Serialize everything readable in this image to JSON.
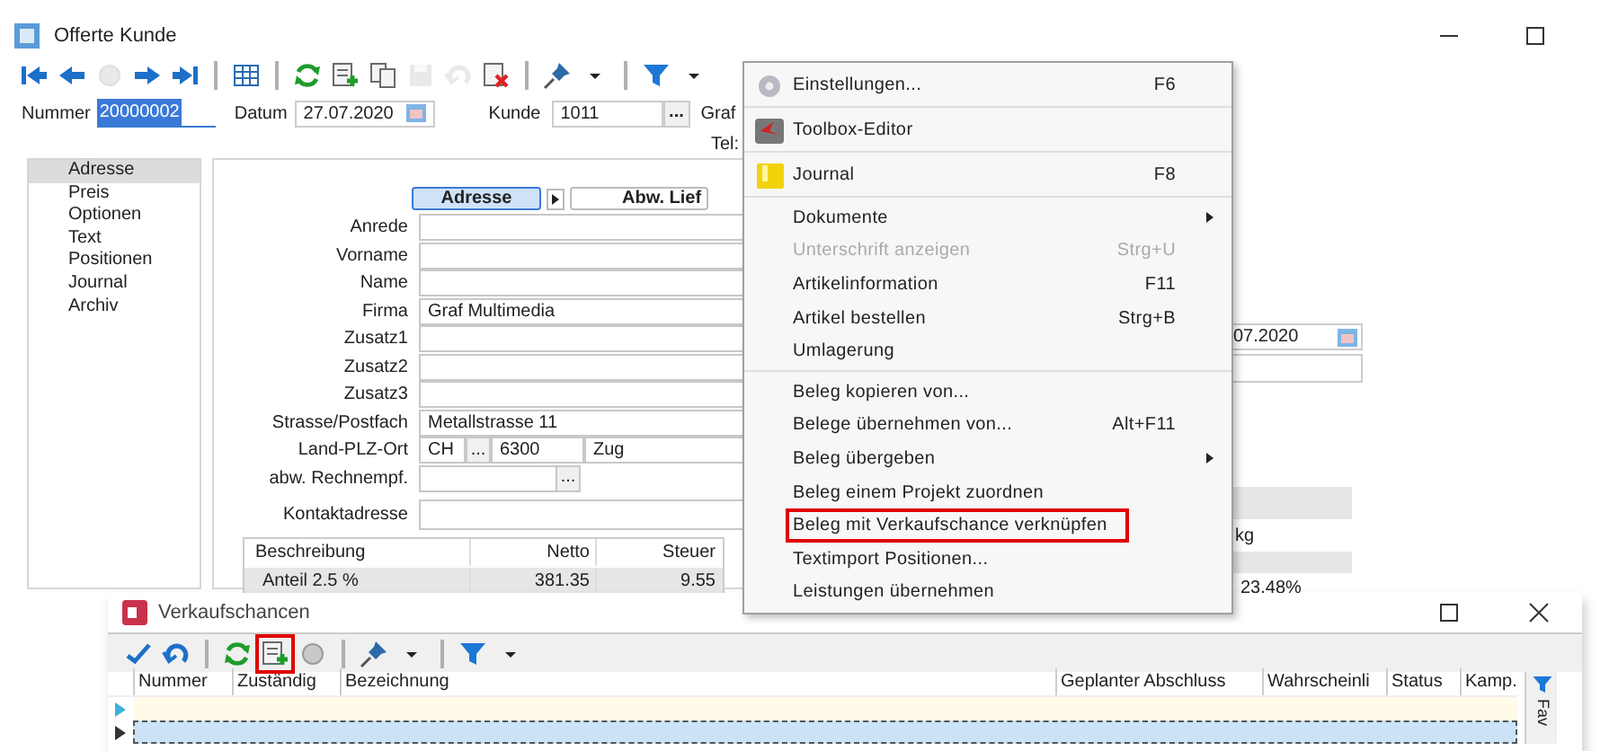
{
  "window": {
    "title": "Offerte Kunde"
  },
  "toolbar": [
    {
      "kind": "first",
      "disabled": false
    },
    {
      "kind": "prev",
      "disabled": false
    },
    {
      "kind": "circle",
      "disabled": true
    },
    {
      "kind": "next",
      "disabled": false
    },
    {
      "kind": "last",
      "disabled": false
    },
    {
      "kind": "sep",
      "disabled": false
    },
    {
      "kind": "table",
      "disabled": false
    },
    {
      "kind": "sep",
      "disabled": false
    },
    {
      "kind": "refresh",
      "disabled": false
    },
    {
      "kind": "new",
      "disabled": false
    },
    {
      "kind": "copy",
      "disabled": false
    },
    {
      "kind": "save",
      "disabled": true
    },
    {
      "kind": "undo",
      "disabled": true
    },
    {
      "kind": "delete",
      "disabled": false
    },
    {
      "kind": "sep",
      "disabled": false
    },
    {
      "kind": "pin",
      "disabled": false
    },
    {
      "kind": "caret",
      "disabled": false
    },
    {
      "kind": "sep",
      "disabled": false
    },
    {
      "kind": "filter",
      "disabled": false
    },
    {
      "kind": "caret",
      "disabled": false
    }
  ],
  "header": {
    "nummer_label": "Nummer",
    "nummer": "20000002",
    "datum_label": "Datum",
    "datum": "27.07.2020",
    "kunde_label": "Kunde",
    "kunde": "1011",
    "kunde_button": "...",
    "kunde_name": "Graf",
    "tel_label": "Tel:"
  },
  "nav": [
    {
      "label": "Adresse",
      "selected": true
    },
    {
      "label": "Preis",
      "selected": false
    },
    {
      "label": "Optionen",
      "selected": false
    },
    {
      "label": "Text",
      "selected": false
    },
    {
      "label": "Positionen",
      "selected": false
    },
    {
      "label": "Journal",
      "selected": false
    },
    {
      "label": "Archiv",
      "selected": false
    }
  ],
  "address_tabs": [
    {
      "label": "Adresse",
      "selected": true
    },
    {
      "label": "Abw. Lief",
      "selected": false
    }
  ],
  "fields": [
    {
      "kind": "text",
      "label": "Anrede"
    },
    {
      "kind": "text",
      "label": "Vorname"
    },
    {
      "kind": "text",
      "label": "Name"
    },
    {
      "kind": "text",
      "label": "Firma",
      "value": "Graf Multimedia"
    },
    {
      "kind": "text",
      "label": "Zusatz1"
    },
    {
      "kind": "text",
      "label": "Zusatz2"
    },
    {
      "kind": "text",
      "label": "Zusatz3"
    },
    {
      "kind": "text",
      "label": "Strasse/Postfach",
      "value": "Metallstrasse 11"
    },
    {
      "kind": "location",
      "label": "Land-PLZ-Ort",
      "country": "CH",
      "button": "...",
      "plz": "6300",
      "ort": "Zug"
    },
    {
      "kind": "picker",
      "label": "abw. Rechnempf.",
      "button": "..."
    },
    {
      "kind": "contact",
      "label": "Kontaktadresse"
    }
  ],
  "summary_table": {
    "columns": [
      "Beschreibung",
      "Netto",
      "Steuer"
    ],
    "rows": [
      [
        "Anteil 2.5 %",
        "381.35",
        "9.55"
      ]
    ]
  },
  "right_panel": {
    "date": "07.2020",
    "unit": "kg",
    "percent": "23.48%"
  },
  "menu": {
    "groups": [
      [
        {
          "label": "Einstellungen...",
          "shortcut": "F6",
          "submenu": false,
          "disabled": false,
          "highlighted": false
        }
      ],
      [
        {
          "label": "Toolbox-Editor",
          "submenu": false,
          "disabled": false,
          "highlighted": false
        }
      ],
      [
        {
          "label": "Journal",
          "shortcut": "F8",
          "submenu": false,
          "disabled": false,
          "highlighted": false
        }
      ],
      [
        {
          "label": "Dokumente",
          "submenu": true,
          "disabled": false,
          "highlighted": false
        },
        {
          "label": "Unterschrift anzeigen",
          "shortcut": "Strg+U",
          "submenu": false,
          "disabled": true,
          "highlighted": false
        },
        {
          "label": "Artikelinformation",
          "shortcut": "F11",
          "submenu": false,
          "disabled": false,
          "highlighted": false
        },
        {
          "label": "Artikel bestellen",
          "shortcut": "Strg+B",
          "submenu": false,
          "disabled": false,
          "highlighted": false
        },
        {
          "label": "Umlagerung",
          "submenu": false,
          "disabled": false,
          "highlighted": false
        }
      ],
      [
        {
          "label": "Beleg kopieren von...",
          "submenu": false,
          "disabled": false,
          "highlighted": false
        },
        {
          "label": "Belege übernehmen von...",
          "shortcut": "Alt+F11",
          "submenu": false,
          "disabled": false,
          "highlighted": false
        },
        {
          "label": "Beleg übergeben",
          "submenu": true,
          "disabled": false,
          "highlighted": false
        },
        {
          "label": "Beleg einem Projekt zuordnen",
          "submenu": false,
          "disabled": false,
          "highlighted": false
        },
        {
          "label": "Beleg mit Verkaufschance verknüpfen",
          "submenu": false,
          "disabled": false,
          "highlighted": true
        },
        {
          "label": "Textimport Positionen...",
          "submenu": false,
          "disabled": false,
          "highlighted": false
        },
        {
          "label": "Leistungen übernehmen",
          "submenu": false,
          "disabled": false,
          "highlighted": false
        }
      ]
    ]
  },
  "chances": {
    "title": "Verkaufschancen",
    "toolbar": [
      {
        "kind": "check",
        "highlighted": false
      },
      {
        "kind": "undo",
        "highlighted": false
      },
      {
        "kind": "sep",
        "highlighted": false
      },
      {
        "kind": "refresh",
        "highlighted": false
      },
      {
        "kind": "new",
        "highlighted": true
      },
      {
        "kind": "circle",
        "highlighted": false
      },
      {
        "kind": "sep",
        "highlighted": false
      },
      {
        "kind": "pin",
        "highlighted": false
      },
      {
        "kind": "caret",
        "highlighted": false
      },
      {
        "kind": "sep",
        "highlighted": false
      },
      {
        "kind": "filter",
        "highlighted": false
      },
      {
        "kind": "caret",
        "highlighted": false
      }
    ],
    "columns": [
      "Nummer",
      "Zuständig",
      "Bezeichnung",
      "Geplanter Abschluss",
      "Wahrscheinli",
      "Status",
      "Kamp."
    ],
    "rows": [
      {
        "kind": "new",
        "selected": false
      },
      {
        "kind": "data",
        "selected": true
      }
    ],
    "side_tab": "Fav"
  }
}
